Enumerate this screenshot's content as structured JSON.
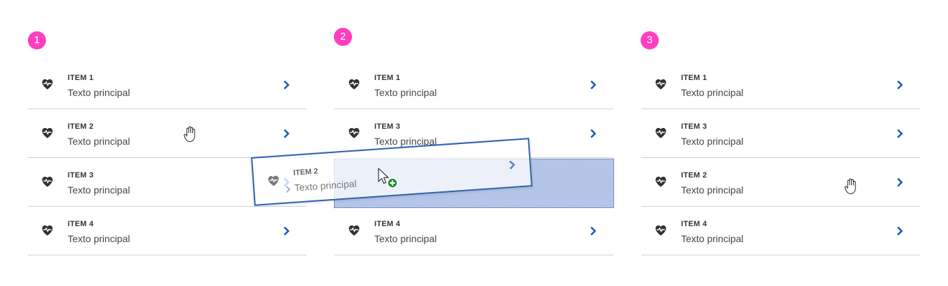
{
  "steps": [
    "1",
    "2",
    "3"
  ],
  "panels": [
    {
      "items": [
        {
          "title": "ITEM 1",
          "text": "Texto principal"
        },
        {
          "title": "ITEM 2",
          "text": "Texto principal"
        },
        {
          "title": "ITEM 3",
          "text": "Texto principal"
        },
        {
          "title": "ITEM 4",
          "text": "Texto principal"
        }
      ]
    },
    {
      "items": [
        {
          "title": "ITEM 1",
          "text": "Texto principal"
        },
        {
          "title": "ITEM 3",
          "text": "Texto principal"
        },
        {
          "title": "ITEM 4",
          "text": "Texto principal"
        }
      ],
      "dragging": {
        "title": "ITEM 2",
        "text": "Texto principal"
      }
    },
    {
      "items": [
        {
          "title": "ITEM 1",
          "text": "Texto principal"
        },
        {
          "title": "ITEM 3",
          "text": "Texto principal"
        },
        {
          "title": "ITEM 2",
          "text": "Texto principal"
        },
        {
          "title": "ITEM 4",
          "text": "Texto principal"
        }
      ]
    }
  ],
  "icons": {
    "row_icon": "heart-pulse-icon",
    "row_action": "chevron-right-icon",
    "grab": "hand-grab-cursor-icon",
    "copy": "arrow-plus-cursor-icon"
  },
  "colors": {
    "badge": "#ff3fbf",
    "accent": "#1f5bb5",
    "dropzone": "#b4c6e7",
    "icon": "#333333"
  }
}
